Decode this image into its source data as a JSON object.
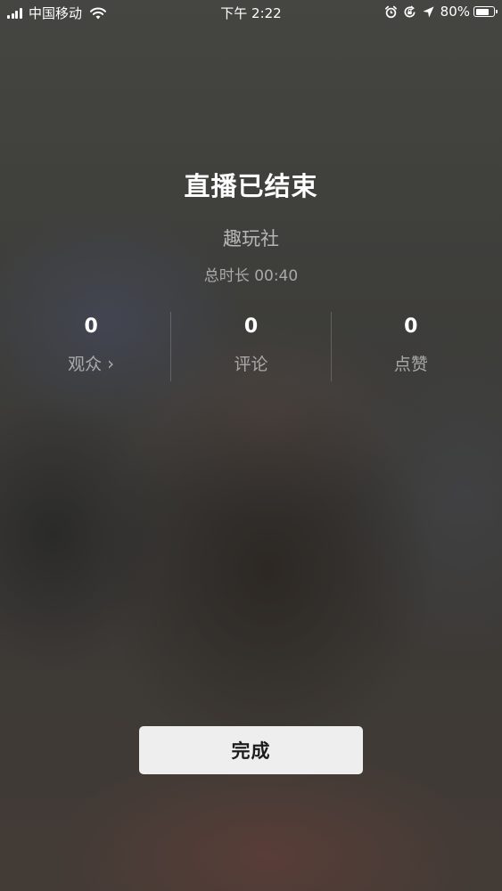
{
  "status_bar": {
    "carrier": "中国移动",
    "time": "下午 2:22",
    "battery_percent": "80%",
    "battery_level": 0.8,
    "icons": [
      "signal-icon",
      "wifi-icon",
      "alarm-icon",
      "orientation-lock-icon",
      "location-arrow-icon",
      "battery-icon"
    ]
  },
  "live_end": {
    "title": "直播已结束",
    "host_name": "趣玩社",
    "duration": "总时长 00:40"
  },
  "stats": [
    {
      "value": "0",
      "label": "观众",
      "chevron": "›"
    },
    {
      "value": "0",
      "label": "评论"
    },
    {
      "value": "0",
      "label": "点赞"
    }
  ],
  "actions": {
    "done_label": "完成"
  },
  "colors": {
    "background": "#3a3a38",
    "button_bg": "#efeeee",
    "text_primary": "#ffffff"
  }
}
